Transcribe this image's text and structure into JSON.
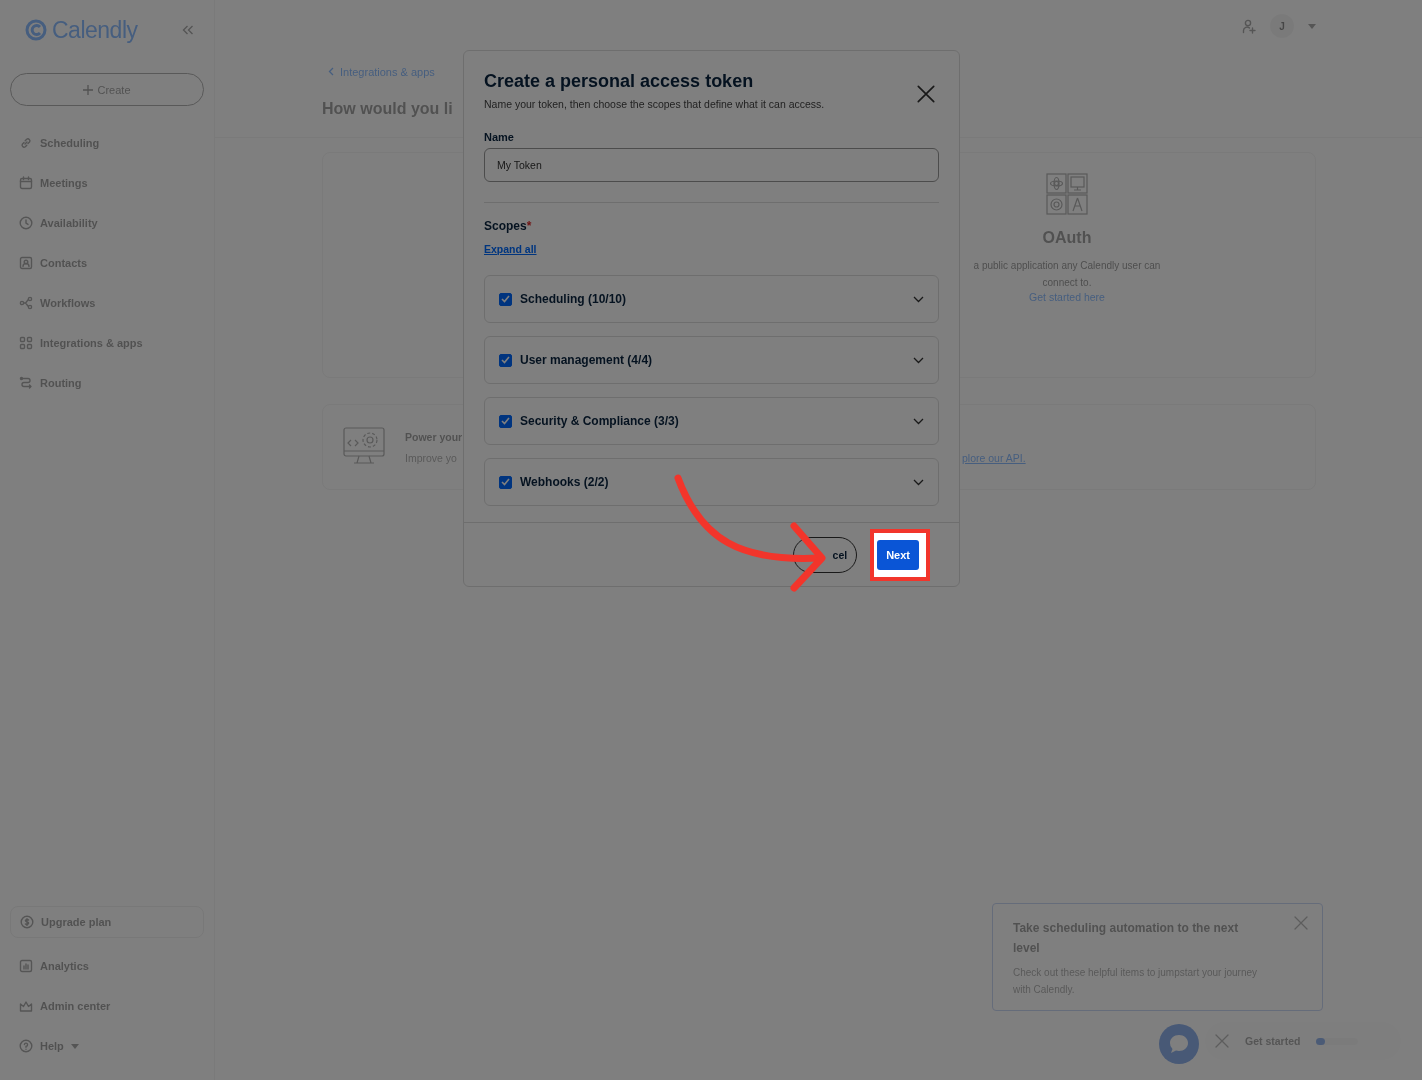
{
  "topbar": {
    "avatar": "J"
  },
  "sidebar": {
    "logo": "Calendly",
    "create_button": "Create",
    "nav": [
      {
        "label": "Scheduling"
      },
      {
        "label": "Meetings"
      },
      {
        "label": "Availability"
      },
      {
        "label": "Contacts"
      },
      {
        "label": "Workflows"
      },
      {
        "label": "Integrations & apps"
      },
      {
        "label": "Routing"
      }
    ],
    "bottom_nav": [
      {
        "label": "Upgrade plan",
        "kind": "promo"
      },
      {
        "label": "Analytics",
        "kind": "link"
      },
      {
        "label": "Admin center",
        "kind": "link"
      },
      {
        "label": "Help",
        "kind": "menu"
      }
    ]
  },
  "breadcrumb": "Integrations & apps",
  "heading": "How would you li",
  "oauth_card": {
    "title": "OAuth",
    "description": "a public application any Calendly user can",
    "description_2": "connect to.",
    "link": "Get started here"
  },
  "api_card": {
    "title": "Power your",
    "text": "Improve yo",
    "link": "plore our API."
  },
  "modal": {
    "title": "Create a personal access token",
    "subtitle": "Name your token, then choose the scopes that define what it can access.",
    "name_label": "Name",
    "name_value": "My Token",
    "scopes_label": "Scopes",
    "required_mark": "*",
    "expand_link": "Expand all",
    "scopes": [
      {
        "label": "Scheduling (10/10)",
        "checked": true,
        "expanded": false
      },
      {
        "label": "User management (4/4)",
        "checked": true,
        "expanded": false
      },
      {
        "label": "Security & Compliance (3/3)",
        "checked": true,
        "expanded": false
      },
      {
        "label": "Webhooks (2/2)",
        "checked": true,
        "expanded": false
      }
    ],
    "cancel_button": "cel",
    "next_button": "Next"
  },
  "tooltip": {
    "title": "Take scheduling automation to the next level",
    "body": "Check out these helpful items to jumpstart your journey with Calendly."
  },
  "widget": {
    "label": "Get started",
    "level": 0.2
  }
}
